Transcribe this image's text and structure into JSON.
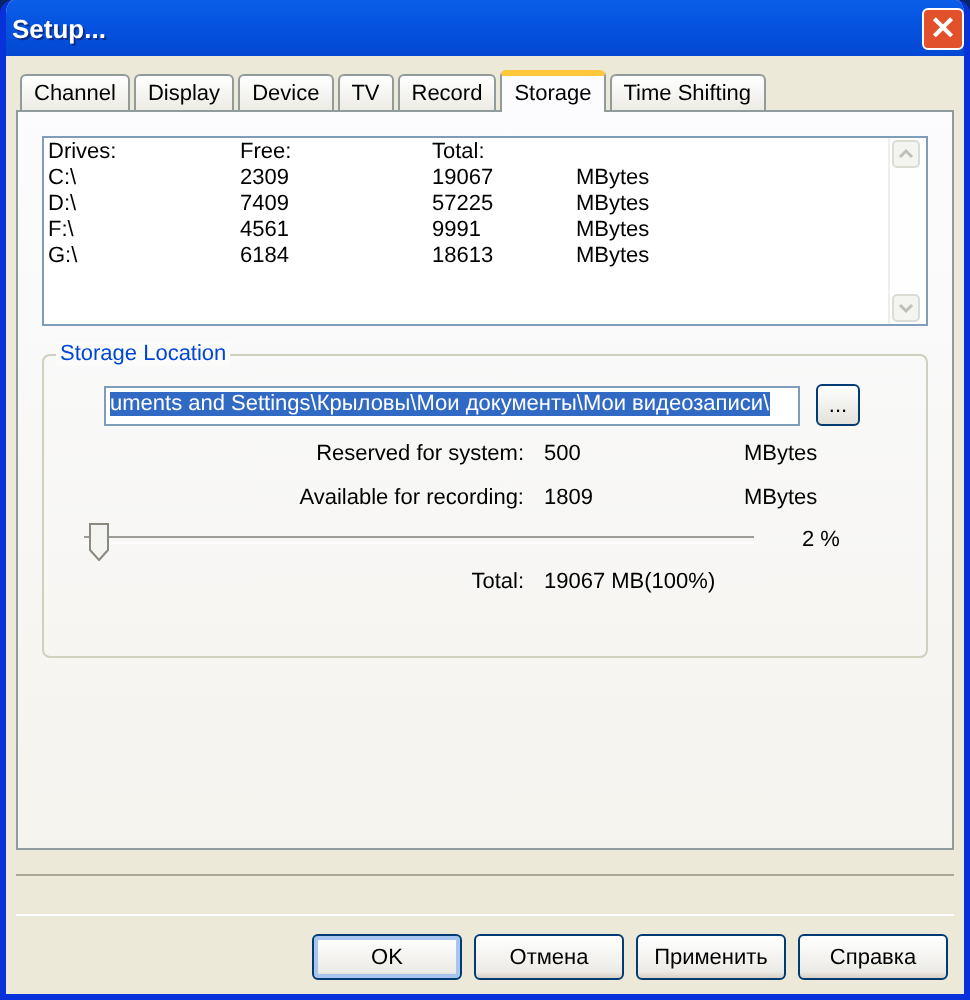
{
  "window": {
    "title": "Setup...",
    "close": "×"
  },
  "tabs": [
    {
      "label": "Channel",
      "selected": false
    },
    {
      "label": "Display",
      "selected": false
    },
    {
      "label": "Device",
      "selected": false
    },
    {
      "label": "TV",
      "selected": false
    },
    {
      "label": "Record",
      "selected": false
    },
    {
      "label": "Storage",
      "selected": true
    },
    {
      "label": "Time Shifting",
      "selected": false
    }
  ],
  "drives": {
    "columns": [
      "Drives:",
      "Free:",
      "Total:"
    ],
    "rows": [
      [
        "C:\\",
        "2309",
        "19067",
        "MBytes"
      ],
      [
        "D:\\",
        "7409",
        "57225",
        "MBytes"
      ],
      [
        "F:\\",
        "4561",
        "9991",
        "MBytes"
      ],
      [
        "G:\\",
        "6184",
        "18613",
        "MBytes"
      ]
    ]
  },
  "storage_location": {
    "title": "Storage Location",
    "path": {
      "value": "uments and Settings\\Крыловы\\Мои документы\\Мои видеозаписи\\",
      "selected": true
    },
    "browse_button": "...",
    "fields": [
      {
        "label": "Reserved for system:",
        "value": "500",
        "unit": "MBytes"
      },
      {
        "label": "Available for recording:",
        "value": "1809",
        "unit": "MBytes"
      }
    ],
    "slider": {
      "level": 0.02,
      "reading": "2 %"
    },
    "total": {
      "label": "Total:",
      "value": "19067 MB(100%)"
    }
  },
  "buttons": [
    {
      "label": "OK",
      "default": true
    },
    {
      "label": "Отмена",
      "default": false
    },
    {
      "label": "Применить",
      "default": false
    },
    {
      "label": "Справка",
      "default": false
    }
  ]
}
